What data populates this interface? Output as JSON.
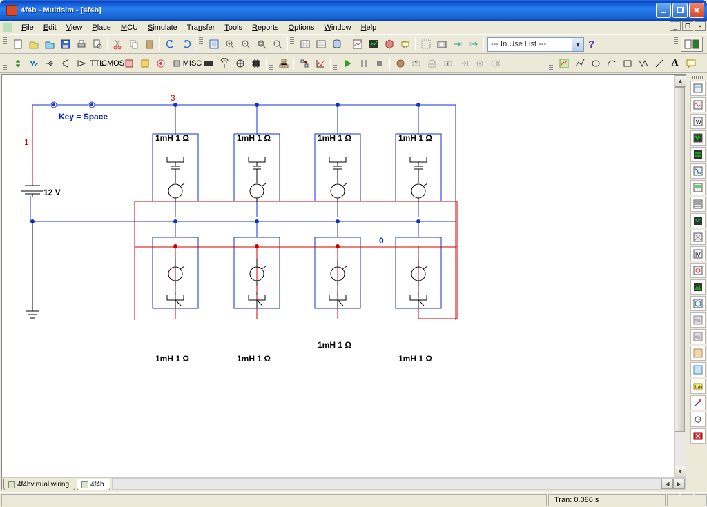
{
  "title": "4f4b - Multisim - [4f4b]",
  "menu": [
    "File",
    "Edit",
    "View",
    "Place",
    "MCU",
    "Simulate",
    "Transfer",
    "Tools",
    "Reports",
    "Options",
    "Window",
    "Help"
  ],
  "in_use_list": "--- In Use List ---",
  "tabs": [
    {
      "label": "4f4bvirtual wiring",
      "active": false
    },
    {
      "label": "4f4b",
      "active": true
    }
  ],
  "status_tran": "Tran: 0.086 s",
  "schematic": {
    "key_label": "Key = Space",
    "net1": "1",
    "net3": "3",
    "net0": "0",
    "voltage": "12 V",
    "top_labels": [
      "1mH 1 Ω",
      "1mH 1 Ω",
      "1mH 1 Ω",
      "1mH 1 Ω"
    ],
    "bottom_labels": [
      "1mH 1 Ω",
      "1mH 1 Ω",
      "1mH 1 Ω",
      "1mH 1 Ω"
    ]
  }
}
